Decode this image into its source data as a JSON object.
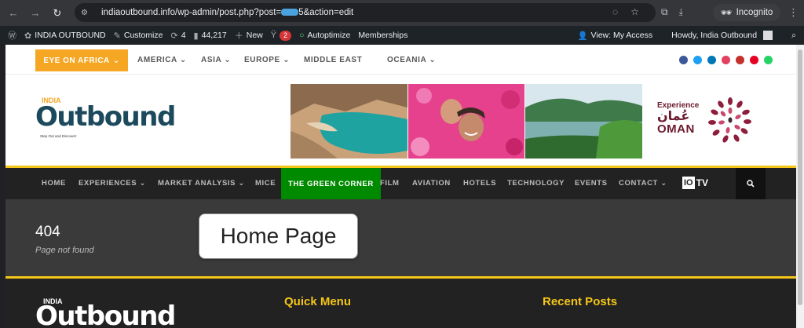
{
  "browser": {
    "url": "indiaoutbound.info/wp-admin/post.php?post=",
    "url_suffix": "5&action=edit",
    "incognito_label": "Incognito"
  },
  "wpbar": {
    "site": "INDIA OUTBOUND",
    "customize": "Customize",
    "updates": "4",
    "comments": "44,217",
    "new": "New",
    "yoast_count": "2",
    "autoptimize": "Autoptimize",
    "memberships": "Memberships",
    "view_access": "View: My Access",
    "howdy": "Howdy, India Outbound"
  },
  "topnav": {
    "eye": "EYE ON AFRICA",
    "regions": [
      "AMERICA",
      "ASIA",
      "EUROPE",
      "MIDDLE EAST",
      "OCEANIA"
    ],
    "social_colors": [
      "#3b5998",
      "#1da1f2",
      "#0077b5",
      "#e4405f",
      "#c4302b",
      "#e60023",
      "#25d366"
    ]
  },
  "logo": {
    "india": "INDIA",
    "name": "Outbound",
    "tagline": "Step Out and Discover!"
  },
  "ad": {
    "experience": "Experience",
    "arabic": "عُمان",
    "oman": "OMAN"
  },
  "mainnav": {
    "items": [
      "HOME",
      "EXPERIENCES",
      "MARKET ANALYSIS",
      "MICE",
      "THE GREEN CORNER",
      "FILM",
      "AVIATION",
      "HOTELS",
      "TECHNOLOGY",
      "EVENTS",
      "CONTACT"
    ],
    "iotv_box": "IO",
    "iotv_tv": "TV"
  },
  "hero": {
    "code": "404",
    "message": "Page not found"
  },
  "tooltip": "Home Page",
  "footer": {
    "india": "INDIA",
    "name": "Outbound",
    "quick_menu": "Quick Menu",
    "recent_posts": "Recent Posts"
  },
  "colors": {
    "accent_orange": "#f5a623",
    "accent_yellow": "#f5c518",
    "brand_teal": "#1c4a5c",
    "green_tab": "#008a00",
    "oman_maroon": "#6b1a2e"
  }
}
